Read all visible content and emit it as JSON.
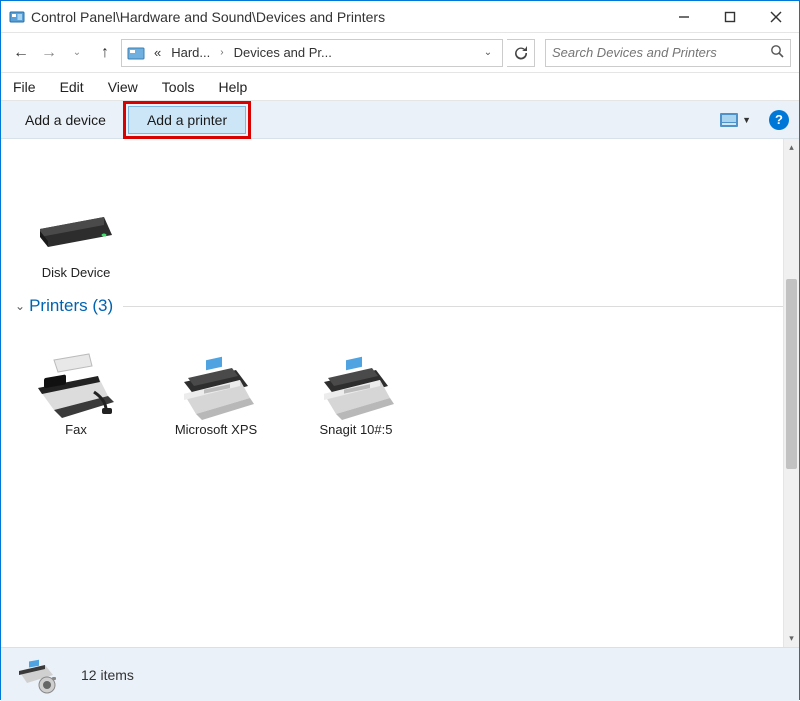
{
  "window": {
    "title": "Control Panel\\Hardware and Sound\\Devices and Printers"
  },
  "breadcrumb": {
    "pre": "«",
    "seg1": "Hard...",
    "seg2": "Devices and Pr..."
  },
  "search": {
    "placeholder": "Search Devices and Printers"
  },
  "menu": {
    "file": "File",
    "edit": "Edit",
    "view": "View",
    "tools": "Tools",
    "help": "Help"
  },
  "toolbar": {
    "add_device": "Add a device",
    "add_printer": "Add a printer"
  },
  "devices": {
    "disk": {
      "label": "Disk Device"
    }
  },
  "printers_section": {
    "title": "Printers",
    "count": "(3)",
    "items": [
      {
        "label": "Fax"
      },
      {
        "label": "Microsoft XPS"
      },
      {
        "label": "Snagit 10#:5"
      }
    ]
  },
  "status": {
    "count_text": "12 items"
  }
}
